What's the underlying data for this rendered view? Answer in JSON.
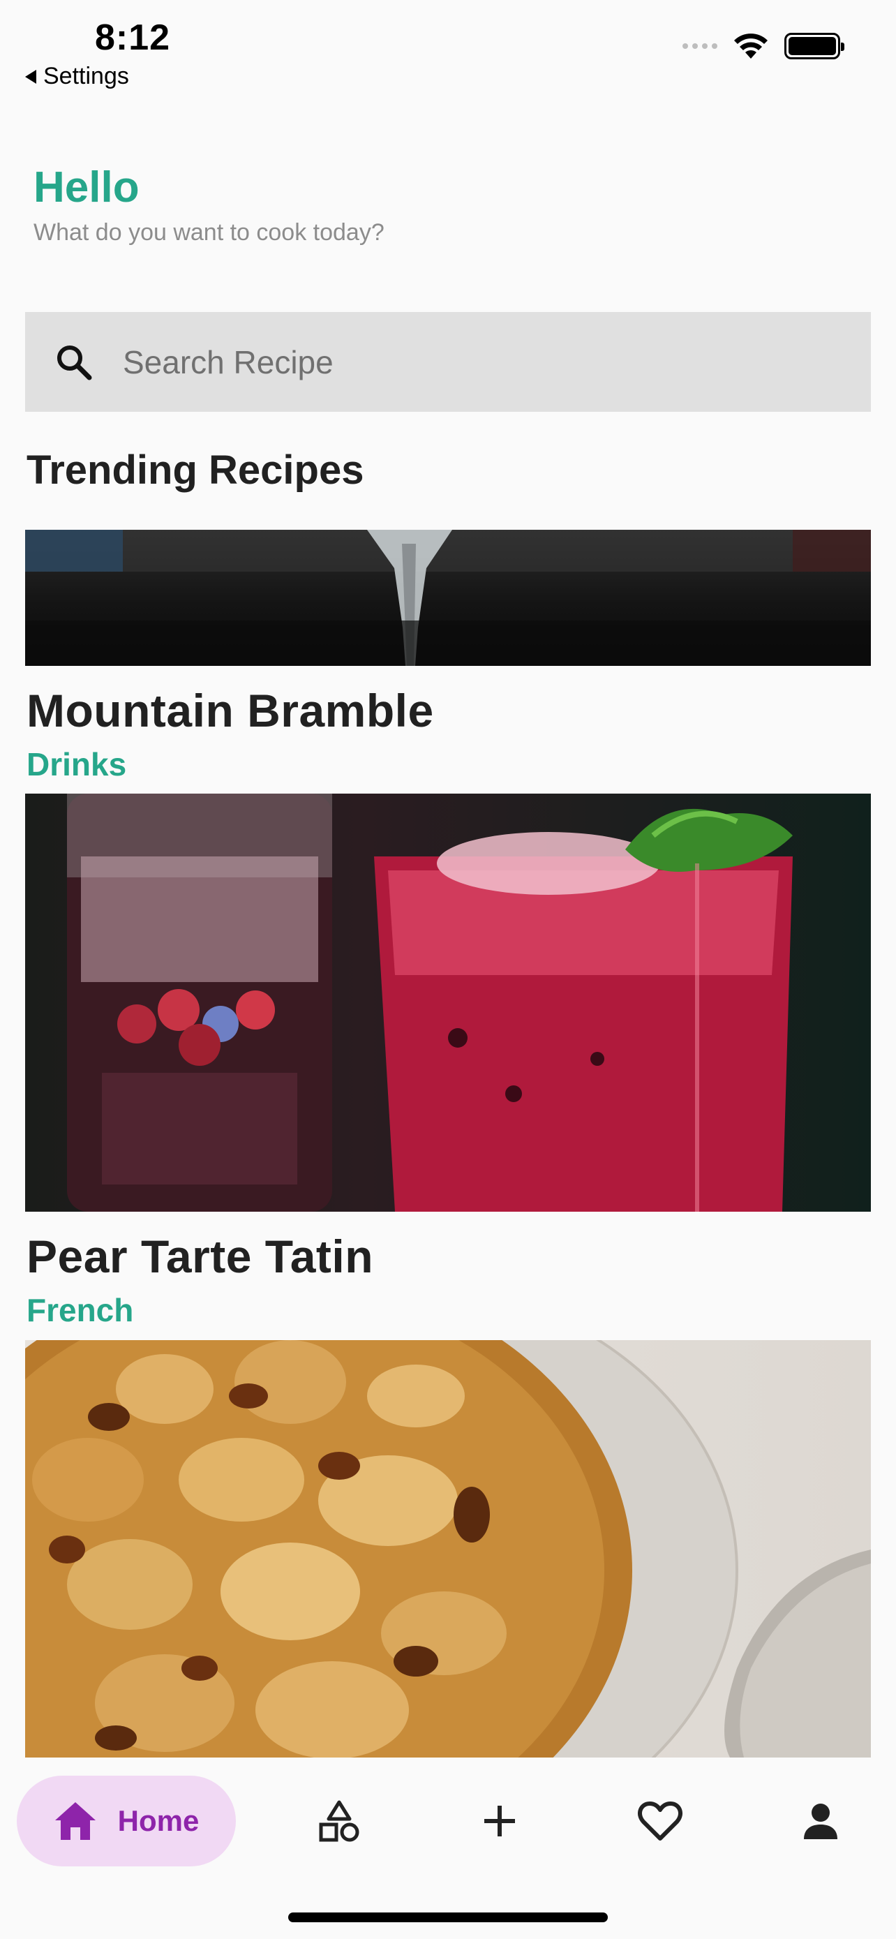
{
  "status_bar": {
    "time": "8:12",
    "back_label": "Settings"
  },
  "greeting": {
    "title": "Hello",
    "subtitle": "What do you want to cook today?"
  },
  "search": {
    "placeholder": "Search Recipe"
  },
  "section": {
    "title": "Trending Recipes"
  },
  "recipes": [
    {
      "title": "Mountain Bramble",
      "category": "Drinks"
    },
    {
      "title": "Pear Tarte Tatin",
      "category": "French"
    }
  ],
  "bottom_nav": {
    "items": [
      {
        "label": "Home",
        "icon": "home-icon",
        "active": true
      },
      {
        "label": "",
        "icon": "shapes-icon"
      },
      {
        "label": "",
        "icon": "plus-icon"
      },
      {
        "label": "",
        "icon": "heart-icon"
      },
      {
        "label": "",
        "icon": "person-icon"
      }
    ]
  },
  "colors": {
    "accent": "#26a68a",
    "nav_active_bg": "#f1d9f4",
    "nav_active_fg": "#8e24aa",
    "search_bg": "#e0e0e0"
  }
}
